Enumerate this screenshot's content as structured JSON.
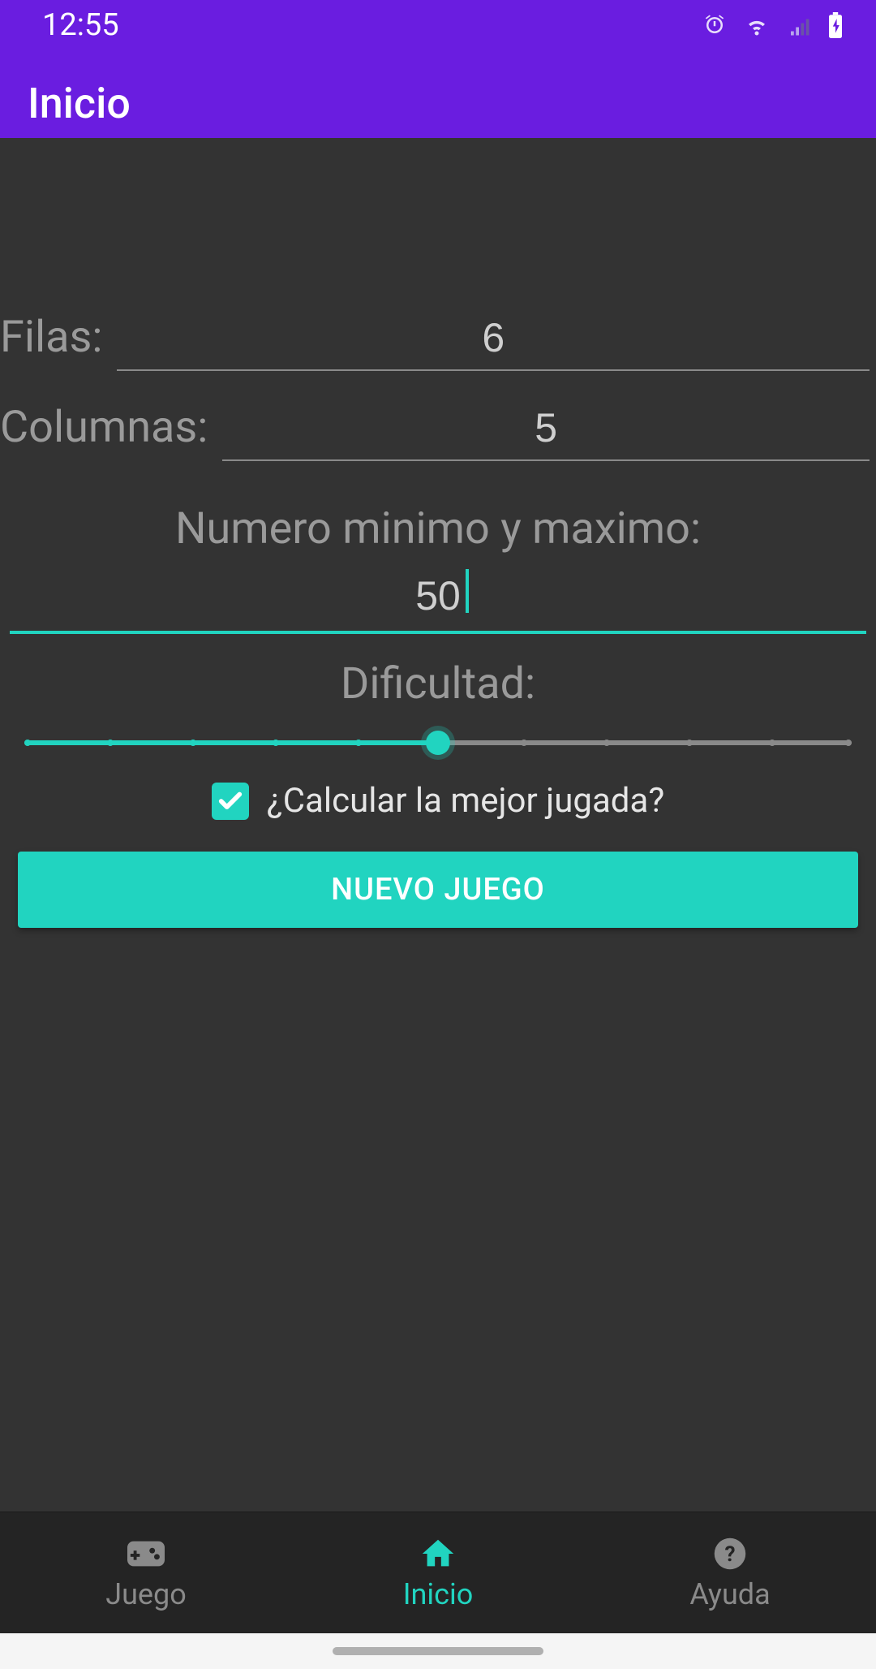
{
  "status": {
    "time": "12:55"
  },
  "app": {
    "title": "Inicio"
  },
  "form": {
    "rows_label": "Filas:",
    "rows_value": "6",
    "cols_label": "Columnas:",
    "cols_value": "5",
    "minmax_label": "Numero minimo y maximo:",
    "minmax_value": "50",
    "difficulty_label": "Dificultad:",
    "difficulty_value": 5,
    "difficulty_max": 10,
    "checkbox_label": "¿Calcular la mejor jugada?",
    "checkbox_checked": true,
    "button_label": "NUEVO JUEGO"
  },
  "nav": {
    "items": [
      {
        "label": "Juego"
      },
      {
        "label": "Inicio"
      },
      {
        "label": "Ayuda"
      }
    ],
    "active_index": 1
  },
  "colors": {
    "accent": "#21d4c0",
    "primary": "#6a1de0"
  }
}
